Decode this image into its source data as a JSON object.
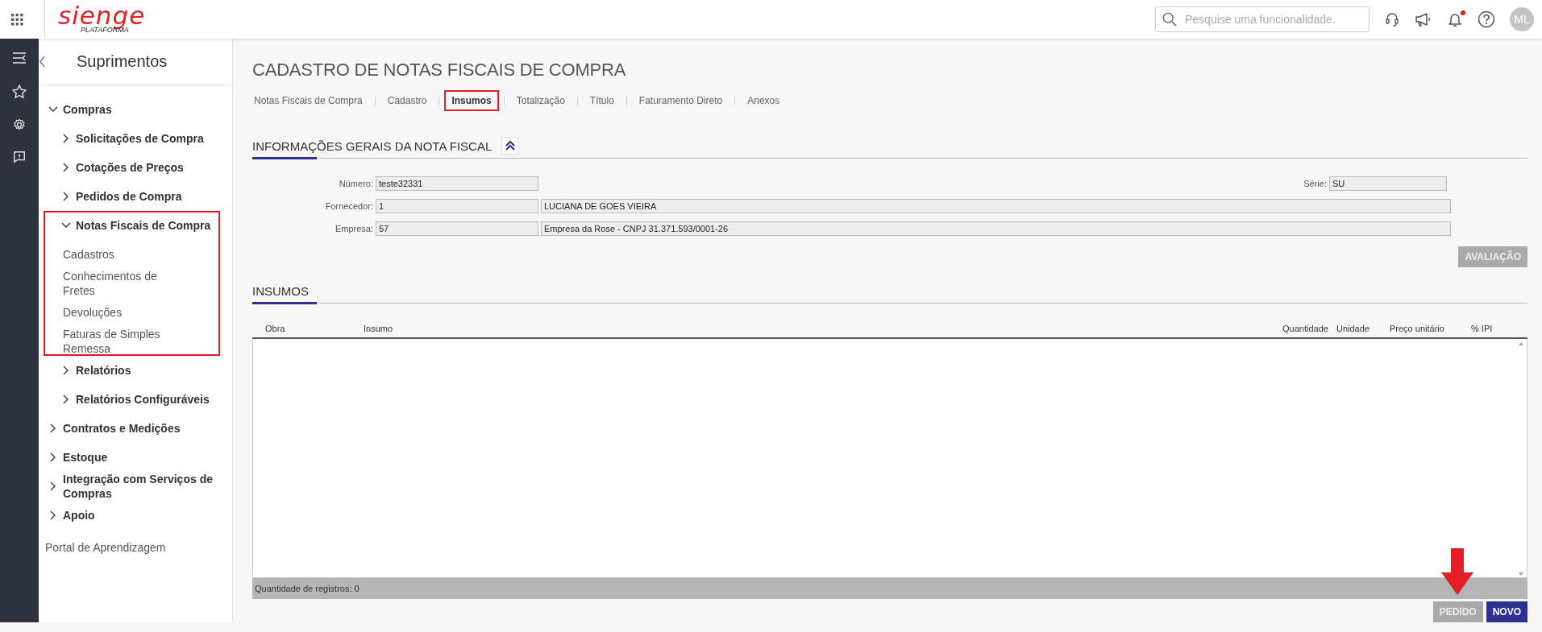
{
  "topbar": {
    "logo": {
      "name": "sienge",
      "tagline": "PLATAFORMA"
    },
    "search": {
      "placeholder": "Pesquise uma funcionalidade."
    },
    "notification_unread": true,
    "avatar": "ML"
  },
  "sidebar": {
    "title": "Suprimentos",
    "items": [
      {
        "label": "Compras",
        "kind": "group",
        "expanded": true,
        "highlighted": false,
        "children": [
          {
            "label": "Solicitações de Compra",
            "kind": "group",
            "expanded": false,
            "highlighted": false
          },
          {
            "label": "Cotações de Preços",
            "kind": "group",
            "expanded": false,
            "highlighted": false
          },
          {
            "label": "Pedidos de Compra",
            "kind": "group",
            "expanded": false,
            "highlighted": false
          },
          {
            "label": "Notas Fiscais de Compra",
            "kind": "group",
            "expanded": true,
            "highlighted": true,
            "children": [
              {
                "label": "Cadastros",
                "kind": "link"
              },
              {
                "label": "Conhecimentos de Fretes",
                "kind": "link"
              },
              {
                "label": "Devoluções",
                "kind": "link"
              },
              {
                "label": "Faturas de Simples Remessa",
                "kind": "link"
              }
            ]
          },
          {
            "label": "Relatórios",
            "kind": "group",
            "expanded": false,
            "highlighted": false
          },
          {
            "label": "Relatórios Configuráveis",
            "kind": "group",
            "expanded": false,
            "highlighted": false
          }
        ]
      },
      {
        "label": "Contratos e Medições",
        "kind": "group",
        "expanded": false,
        "highlighted": false
      },
      {
        "label": "Estoque",
        "kind": "group",
        "expanded": false,
        "highlighted": false
      },
      {
        "label": "Integração com Serviços de Compras",
        "kind": "group",
        "expanded": false,
        "highlighted": false
      },
      {
        "label": "Apoio",
        "kind": "group",
        "expanded": false,
        "highlighted": false
      },
      {
        "label": "Portal de Aprendizagem",
        "kind": "link"
      }
    ]
  },
  "page": {
    "title": "CADASTRO DE NOTAS FISCAIS DE COMPRA",
    "tabs": [
      {
        "label": "Notas Fiscais de Compra",
        "selected": false,
        "highlighted": false
      },
      {
        "label": "Cadastro",
        "selected": false,
        "highlighted": false
      },
      {
        "label": "Insumos",
        "selected": true,
        "highlighted": true
      },
      {
        "label": "Totalização",
        "selected": false,
        "highlighted": false
      },
      {
        "label": "Título",
        "selected": false,
        "highlighted": false
      },
      {
        "label": "Faturamento Direto",
        "selected": false,
        "highlighted": false
      },
      {
        "label": "Anexos",
        "selected": false,
        "highlighted": false
      }
    ],
    "general": {
      "title": "INFORMAÇÕES GERAIS DA NOTA FISCAL",
      "expanded": true,
      "numero": {
        "label": "Número:",
        "value": "teste32331"
      },
      "serie": {
        "label": "Série:",
        "value": "SU"
      },
      "fornecedor": {
        "label": "Fornecedor:",
        "code": "1",
        "name": "LUCIANA DE GOES VIEIRA"
      },
      "empresa": {
        "label": "Empresa:",
        "code": "57",
        "name": "Empresa da Rose - CNPJ 31.371.593/0001-26"
      },
      "button": {
        "label": "AVALIAÇÃO",
        "disabled": true
      }
    },
    "insumos": {
      "title": "INSUMOS",
      "columns": [
        "Obra",
        "Insumo",
        "Quantidade",
        "Unidade",
        "Preço unitário",
        "% IPI"
      ],
      "footer": "Quantidade de registros: 0"
    },
    "buttons": [
      {
        "label": "PEDIDO",
        "disabled": true,
        "marked": true
      },
      {
        "label": "NOVO",
        "disabled": false,
        "marked": false
      }
    ]
  }
}
